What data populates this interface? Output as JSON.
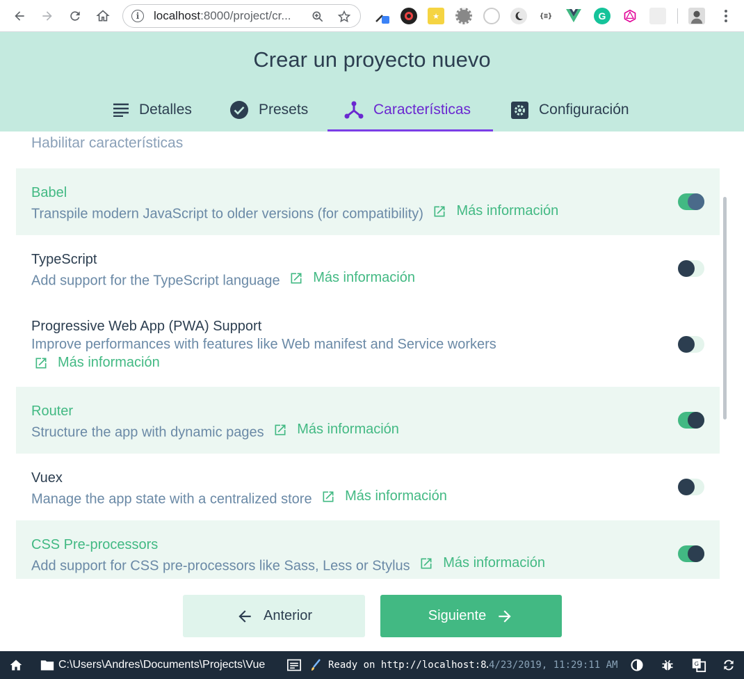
{
  "browser": {
    "url_host": "localhost",
    "url_rest": ":8000/project/cr...",
    "icons": [
      "back-icon",
      "forward-icon",
      "reload-icon",
      "home-icon",
      "info-icon",
      "zoom-icon",
      "star-icon",
      "menu-icon"
    ]
  },
  "app": {
    "title": "Crear un proyecto nuevo",
    "tabs": [
      {
        "label": "Detalles",
        "icon": "list-icon"
      },
      {
        "label": "Presets",
        "icon": "check-circle-icon"
      },
      {
        "label": "Características",
        "icon": "features-icon",
        "active": true
      },
      {
        "label": "Configuración",
        "icon": "settings-icon"
      }
    ]
  },
  "content": {
    "section_heading": "Habilitar características",
    "more_info": "Más información",
    "features": [
      {
        "name": "Babel",
        "description": "Transpile modern JavaScript to older versions (for compatibility)",
        "enabled": true
      },
      {
        "name": "TypeScript",
        "description": "Add support for the TypeScript language",
        "enabled": false
      },
      {
        "name": "Progressive Web App (PWA) Support",
        "description": "Improve performances with features like Web manifest and Service workers",
        "enabled": false
      },
      {
        "name": "Router",
        "description": "Structure the app with dynamic pages",
        "enabled": true
      },
      {
        "name": "Vuex",
        "description": "Manage the app state with a centralized store",
        "enabled": false
      },
      {
        "name": "CSS Pre-processors",
        "description": "Add support for CSS pre-processors like Sass, Less or Stylus",
        "enabled": true
      }
    ]
  },
  "footer": {
    "prev_label": "Anterior",
    "next_label": "Siguiente"
  },
  "statusbar": {
    "path": "C:\\Users\\Andres\\Documents\\Projects\\Vue",
    "status": "Ready on http://localhost:8…",
    "timestamp": "4/23/2019, 11:29:11 AM"
  },
  "colors": {
    "accent": "#42b983",
    "header_bg": "#c4eadf",
    "active_tab": "#6a28d0",
    "statusbar_bg": "#1d2b3a"
  }
}
